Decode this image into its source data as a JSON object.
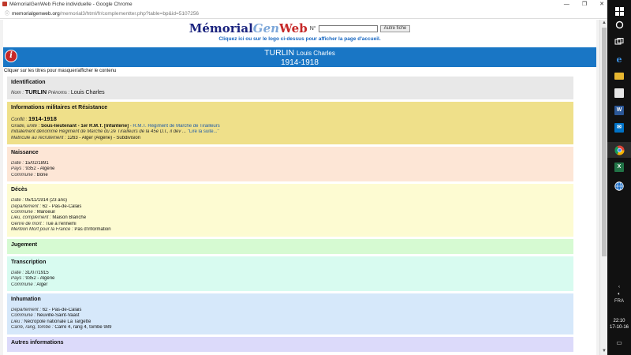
{
  "window": {
    "title": "MémorialGenWeb Fiche individuelle - Google Chrome",
    "minimize": "—",
    "maximize": "❐",
    "close": "✕"
  },
  "address": {
    "host": "memorialgenweb.org",
    "path": "/memorial3/html/fr/complementter.php?table=bp&id=5107256"
  },
  "header": {
    "logo_part1": "Mémorial",
    "logo_part2": "Gen",
    "logo_part3": "Web",
    "num_label": "N°",
    "num_value": "",
    "other_button": "Autre fiche",
    "hint": "Cliquez ici ou sur le logo ci-dessus pour afficher la page d'accueil."
  },
  "person": {
    "surname": "TURLIN",
    "first_names": "Louis Charles",
    "period": "1914-1918"
  },
  "instructions": "Cliquer sur les titres pour masquer/afficher le contenu",
  "sections": {
    "identification": {
      "title": "Identification",
      "nom_label": "Nom :",
      "nom": "TURLIN",
      "prenoms_label": "Prénoms :",
      "prenoms": "Louis Charles"
    },
    "militaire": {
      "title": "Informations militaires et Résistance",
      "conflit_label": "Conflit :",
      "conflit": "1914-1918",
      "grade_label": "Grade, unité :",
      "grade": "Sous-lieutenant - 1er R.M.T. [Infanterie]",
      "grade_link": " - R.M.T. Régiment de Marche de Tirailleurs",
      "initial": "Initialement dénommé Régiment de Marche du 2e Tirailleurs de la 45e D.I., il dev ...",
      "lire_suite": "\"Lire la suite...\"",
      "matricule_label": "Matricule au recrutement :",
      "matricule": "1263 - Alger (Algérie) - Subdivision"
    },
    "naissance": {
      "title": "Naissance",
      "date_label": "Date :",
      "date": "15/02/1891",
      "pays_label": "Pays :",
      "pays": "9352 - Algérie",
      "commune_label": "Commune :",
      "commune": "Bône"
    },
    "deces": {
      "title": "Décès",
      "date_label": "Date :",
      "date": "05/11/1914  (23 ans)",
      "dept_label": "Département :",
      "dept": "62 - Pas-de-Calais",
      "commune_label": "Commune :",
      "commune": "Maroeuil",
      "lieu_label": "Lieu, complément :",
      "lieu": "Maison Blanche",
      "genre_label": "Genre de mort :",
      "genre": "Tué à l'ennemi",
      "mention_label": "Mention Mort pour la France :",
      "mention": "Pas d'information"
    },
    "jugement": {
      "title": "Jugement"
    },
    "transcription": {
      "title": "Transcription",
      "date_label": "Date :",
      "date": "31/07/1915",
      "pays_label": "Pays :",
      "pays": "9352 - Algérie",
      "commune_label": "Commune :",
      "commune": "Alger"
    },
    "inhumation": {
      "title": "Inhumation",
      "dept_label": "Département :",
      "dept": "62 - Pas-de-Calais",
      "commune_label": "Commune :",
      "commune": "Neuville-Saint-Vaast",
      "lieu_label": "Lieu :",
      "lieu": "Nécropole nationale La Targette",
      "carre_label": "Carré, rang, tombe :",
      "carre": "Carré 4, rang 4, tombe 989"
    },
    "autres": {
      "title": "Autres informations"
    }
  },
  "taskbar": {
    "tray_keyboard": "FRA",
    "time": "22:10",
    "date": "17-10-16"
  }
}
